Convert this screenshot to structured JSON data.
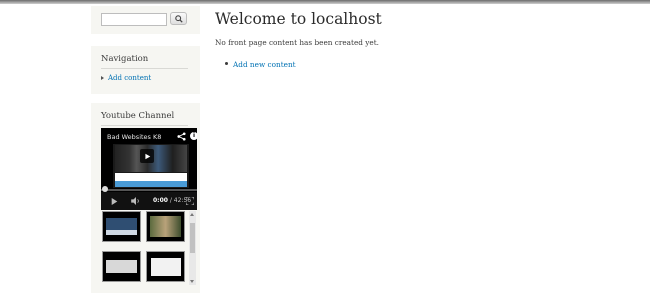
{
  "search": {
    "placeholder": "",
    "value": ""
  },
  "navigation": {
    "title": "Navigation",
    "items": [
      {
        "label": "Add content"
      }
    ]
  },
  "youtube": {
    "title": "Youtube Channel",
    "video_title": "Bad Websites K8",
    "time_current": "0:00",
    "time_total": "/ 42:56",
    "progress": 0
  },
  "main": {
    "title": "Welcome to localhost",
    "text": "No front page content has been created yet.",
    "links": [
      {
        "label": "Add new content"
      }
    ]
  },
  "colors": {
    "link": "#0071b3",
    "sidebar_bg": "#f6f6f2"
  }
}
